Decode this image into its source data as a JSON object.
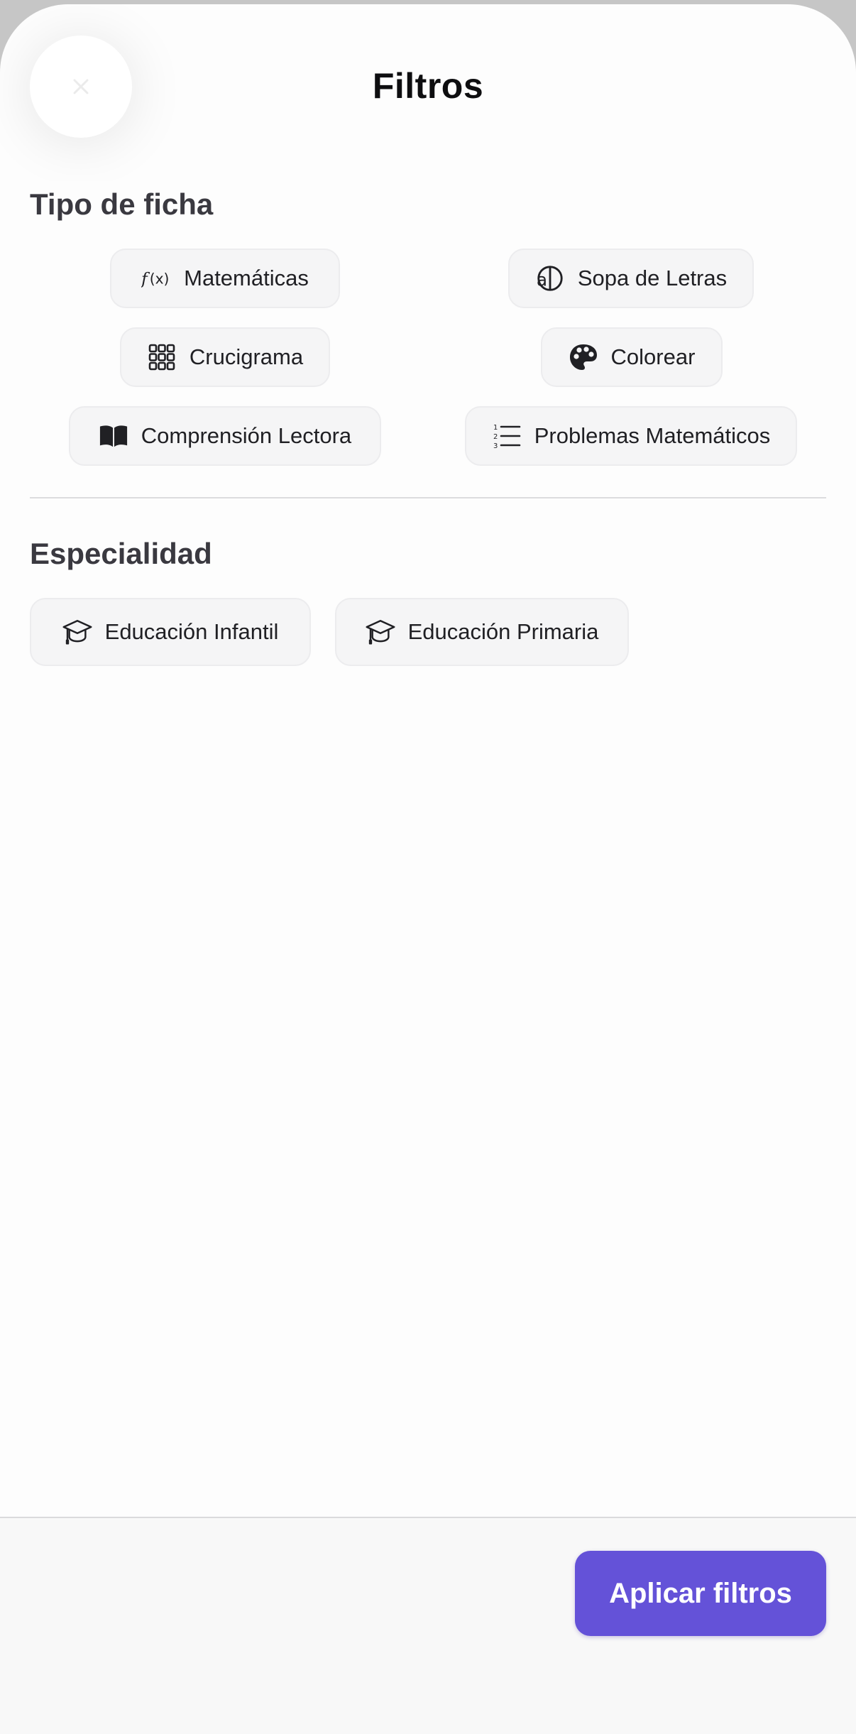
{
  "header": {
    "title": "Filtros",
    "close_icon": "close-icon"
  },
  "tipo_ficha": {
    "title": "Tipo de ficha",
    "chips": [
      {
        "label": "Matemáticas",
        "icon": "function-icon"
      },
      {
        "label": "Sopa de Letras",
        "icon": "letters-icon"
      },
      {
        "label": "Crucigrama",
        "icon": "grid-icon"
      },
      {
        "label": "Colorear",
        "icon": "palette-icon"
      },
      {
        "label": "Comprensión Lectora",
        "icon": "book-icon"
      },
      {
        "label": "Problemas Matemáticos",
        "icon": "numbered-list-icon"
      }
    ]
  },
  "especialidad": {
    "title": "Especialidad",
    "chips": [
      {
        "label": "Educación Infantil",
        "icon": "graduation-cap-icon"
      },
      {
        "label": "Educación Primaria",
        "icon": "graduation-cap-icon"
      }
    ]
  },
  "footer": {
    "apply_label": "Aplicar filtros"
  },
  "colors": {
    "accent": "#6452d8",
    "chip_bg": "#f5f5f6",
    "section_title": "#3a3940"
  }
}
